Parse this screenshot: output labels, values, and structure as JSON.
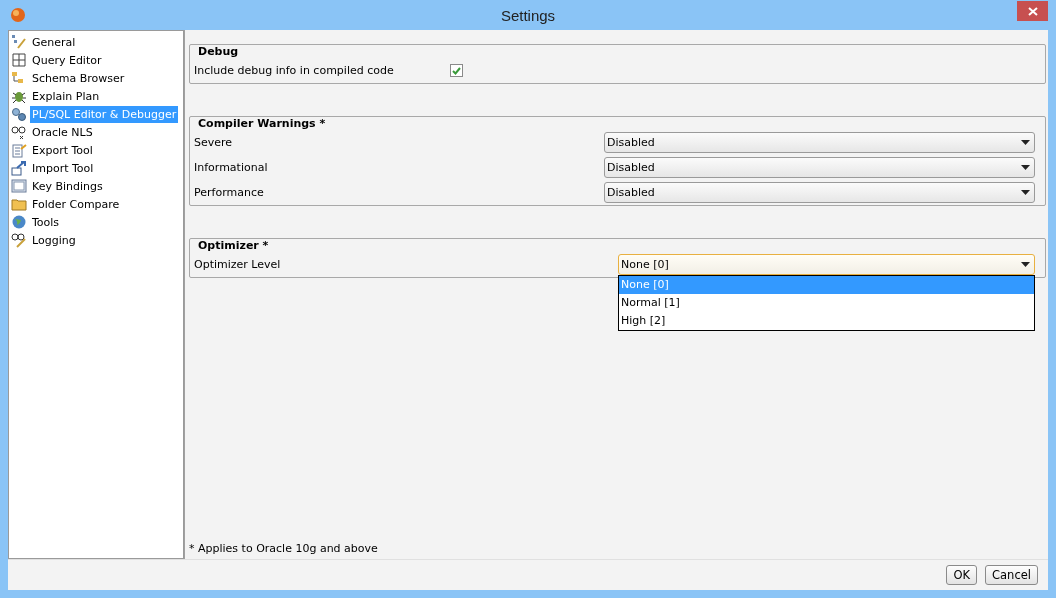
{
  "window": {
    "title": "Settings"
  },
  "sidebar": {
    "items": [
      {
        "label": "General",
        "selected": false
      },
      {
        "label": "Query Editor",
        "selected": false
      },
      {
        "label": "Schema Browser",
        "selected": false
      },
      {
        "label": "Explain Plan",
        "selected": false
      },
      {
        "label": "PL/SQL Editor & Debugger",
        "selected": true
      },
      {
        "label": "Oracle NLS",
        "selected": false
      },
      {
        "label": "Export Tool",
        "selected": false
      },
      {
        "label": "Import Tool",
        "selected": false
      },
      {
        "label": "Key Bindings",
        "selected": false
      },
      {
        "label": "Folder Compare",
        "selected": false
      },
      {
        "label": "Tools",
        "selected": false
      },
      {
        "label": "Logging",
        "selected": false
      }
    ]
  },
  "sections": [
    {
      "title": "Debug",
      "rows": [
        {
          "kind": "checkbox",
          "label": "Include debug info in compiled code",
          "checked": true
        }
      ]
    },
    {
      "title": "Compiler Warnings *",
      "rows": [
        {
          "kind": "select",
          "label": "Severe",
          "value": "Disabled",
          "open": false
        },
        {
          "kind": "select",
          "label": "Informational",
          "value": "Disabled",
          "open": false
        },
        {
          "kind": "select",
          "label": "Performance",
          "value": "Disabled",
          "open": false
        }
      ]
    },
    {
      "title": "Optimizer *",
      "rows": [
        {
          "kind": "select",
          "label": "Optimizer Level",
          "value": "None [0]",
          "open": true,
          "options": [
            {
              "label": "None [0]",
              "selected": true
            },
            {
              "label": "Normal [1]",
              "selected": false
            },
            {
              "label": "High [2]",
              "selected": false
            }
          ]
        }
      ]
    }
  ],
  "footnote": "* Applies to Oracle 10g and above",
  "buttons": [
    "OK",
    "Cancel"
  ]
}
